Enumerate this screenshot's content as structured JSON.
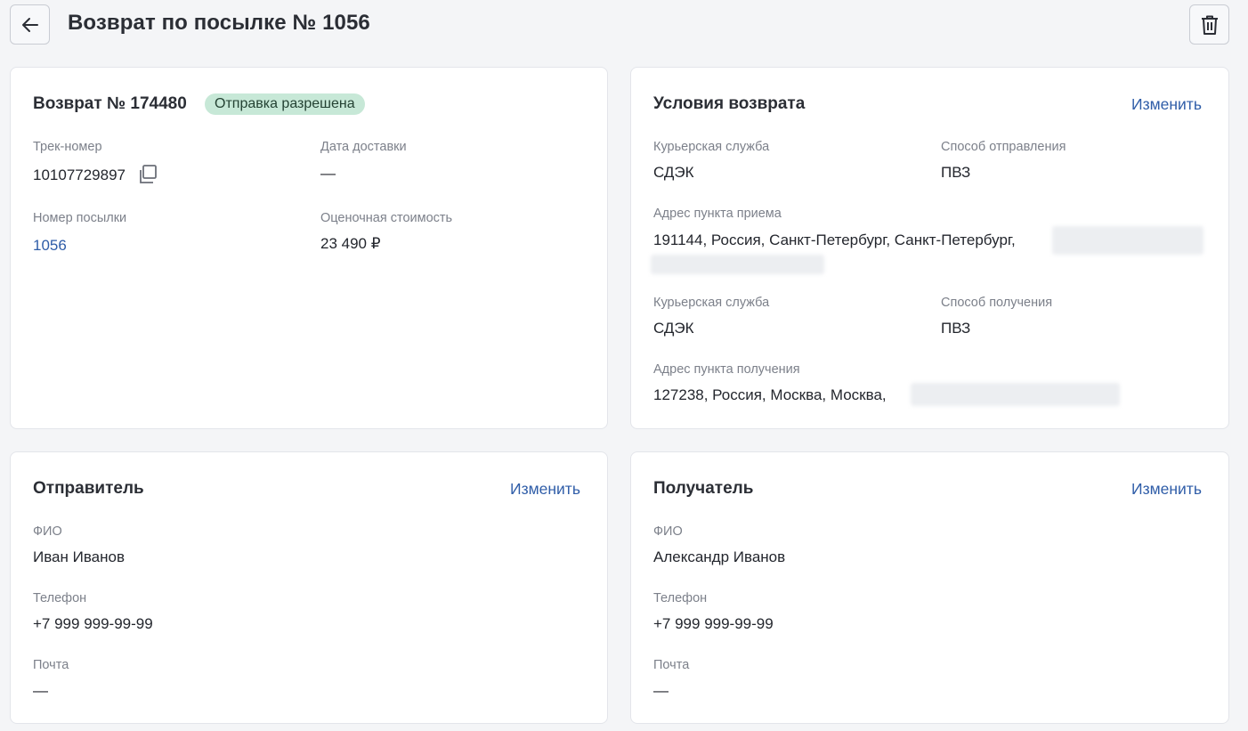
{
  "header": {
    "title": "Возврат по посылке № 1056",
    "back_icon": "arrow-left-icon",
    "delete_icon": "trash-icon"
  },
  "return_card": {
    "title": "Возврат № 174480",
    "status_badge": "Отправка разрешена",
    "status_color": "#c7e8d7",
    "track_label": "Трек-номер",
    "track_value": "10107729897",
    "delivery_date_label": "Дата доставки",
    "delivery_date_value": "—",
    "parcel_number_label": "Номер посылки",
    "parcel_number_value": "1056",
    "estimated_cost_label": "Оценочная стоимость",
    "estimated_cost_value": "23 490 ₽"
  },
  "terms_card": {
    "title": "Условия возврата",
    "edit_label": "Изменить",
    "send_courier_label": "Курьерская служба",
    "send_courier_value": "СДЭК",
    "send_method_label": "Способ отправления",
    "send_method_value": "ПВЗ",
    "pickup_address_label": "Адрес пункта приема",
    "pickup_address_value": "191144, Россия, Санкт-Петербург, Санкт-Петербург,",
    "receive_courier_label": "Курьерская служба",
    "receive_courier_value": "СДЭК",
    "receive_method_label": "Способ получения",
    "receive_method_value": "ПВЗ",
    "delivery_address_label": "Адрес пункта получения",
    "delivery_address_value": "127238, Россия, Москва, Москва,"
  },
  "sender_card": {
    "title": "Отправитель",
    "edit_label": "Изменить",
    "name_label": "ФИО",
    "name_value": "Иван Иванов",
    "phone_label": "Телефон",
    "phone_value": "+7 999 999-99-99",
    "email_label": "Почта",
    "email_value": "—"
  },
  "recipient_card": {
    "title": "Получатель",
    "edit_label": "Изменить",
    "name_label": "ФИО",
    "name_value": "Александр Иванов",
    "phone_label": "Телефон",
    "phone_value": "+7 999 999-99-99",
    "email_label": "Почта",
    "email_value": "—"
  },
  "colors": {
    "accent_link": "#2f5da8",
    "background": "#f4f5f7"
  }
}
